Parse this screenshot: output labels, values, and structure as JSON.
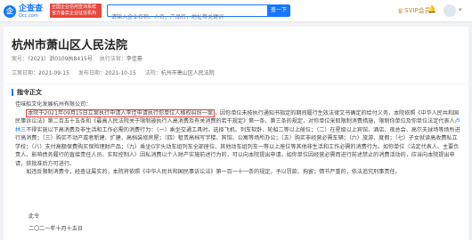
{
  "header": {
    "logo_cn": "企查查",
    "logo_en": "Qcc.com",
    "slogan": "全国企业信用查询系统官方备案企业征信机构",
    "search_placeholder": "请输入企业名称、人名，产品名，地址等关键词",
    "search_button": "查一下",
    "vip_label": "SVIP会员",
    "icons": [
      "bell-icon",
      "avatar",
      "chevron-down-icon"
    ]
  },
  "document": {
    "title": "杭州市萧山区人民法院",
    "case_no_label": "案号：",
    "case_no": "（2021）浙0109执8415号",
    "executor_label": "执行法官：",
    "executor": "李佳豪",
    "filing_label": "立案日期：",
    "filing_date": "2021-09-15",
    "publish_label": "发布日期：",
    "publish_date": "2021-10-15",
    "court_label": "法院：",
    "court": "杭州市萧山区人民法院"
  },
  "section": {
    "heading": "指令正文"
  },
  "body": {
    "addressee": "佳味船文化发展杭州有限公司：",
    "p1_highlight": "本院于2021年09月15日立案执行申请人李佳申请执行你单位人格权纠纷一案",
    "p1_a": "，因你单位未按执行通知书指定的期间履行生效法律文书确定的给付义务，本院依照《中华人民共和国民事诉讼法》第二百五十五条和《最高人民法院关于限制被执行人高消费及有关消费的若干规定》第一条、第三条的规定，对你单位采取限制消费措施，限制你单位及你单位法定代表人",
    "p1_link": "卢林三",
    "p1_b": "不得实施以下高消费及非生活和工作必需的消费行为：（一）乘坐交通工具时，选择飞机、列车软卧、轮船二等以上舱位；（二）在星级以上宾馆、酒店、夜总会、高尔夫球场等场所进行高消费；（三）购买不动产或者新建、扩建、高档装修房屋；（四）租赁高档写字楼、宾馆、公寓等场所办公；（五）购买非经营必需车辆；（六）旅游、度假；（七）子女就读高收费私立学校；（八）支付高额保费购买保险理财产品；（九）乘坐G字头动车组列车全部座位、其他动车组列车一等以上座位等其他非生活和工作必需的消费行为。如你单位（法定代表人、主要负责人、影响债务履行的直接责任人员、实际控制人）因私消费以个人财产实施前述行为的，可以向本院提出申请。如你单位因经营必需而进行前述禁止的消费活动的，应当向本院提出申请，获批准后方可进行。",
    "p2": "如违反限制消费令，经查证属实的，本院将依照《中华人民共和国民事诉讼法》第一百一十一条的规定，予以罚款、拘留；情节严重的，依法追究刑事责任。",
    "sign_1": "此令",
    "sign_2": "二〇二一年十月十五日"
  }
}
